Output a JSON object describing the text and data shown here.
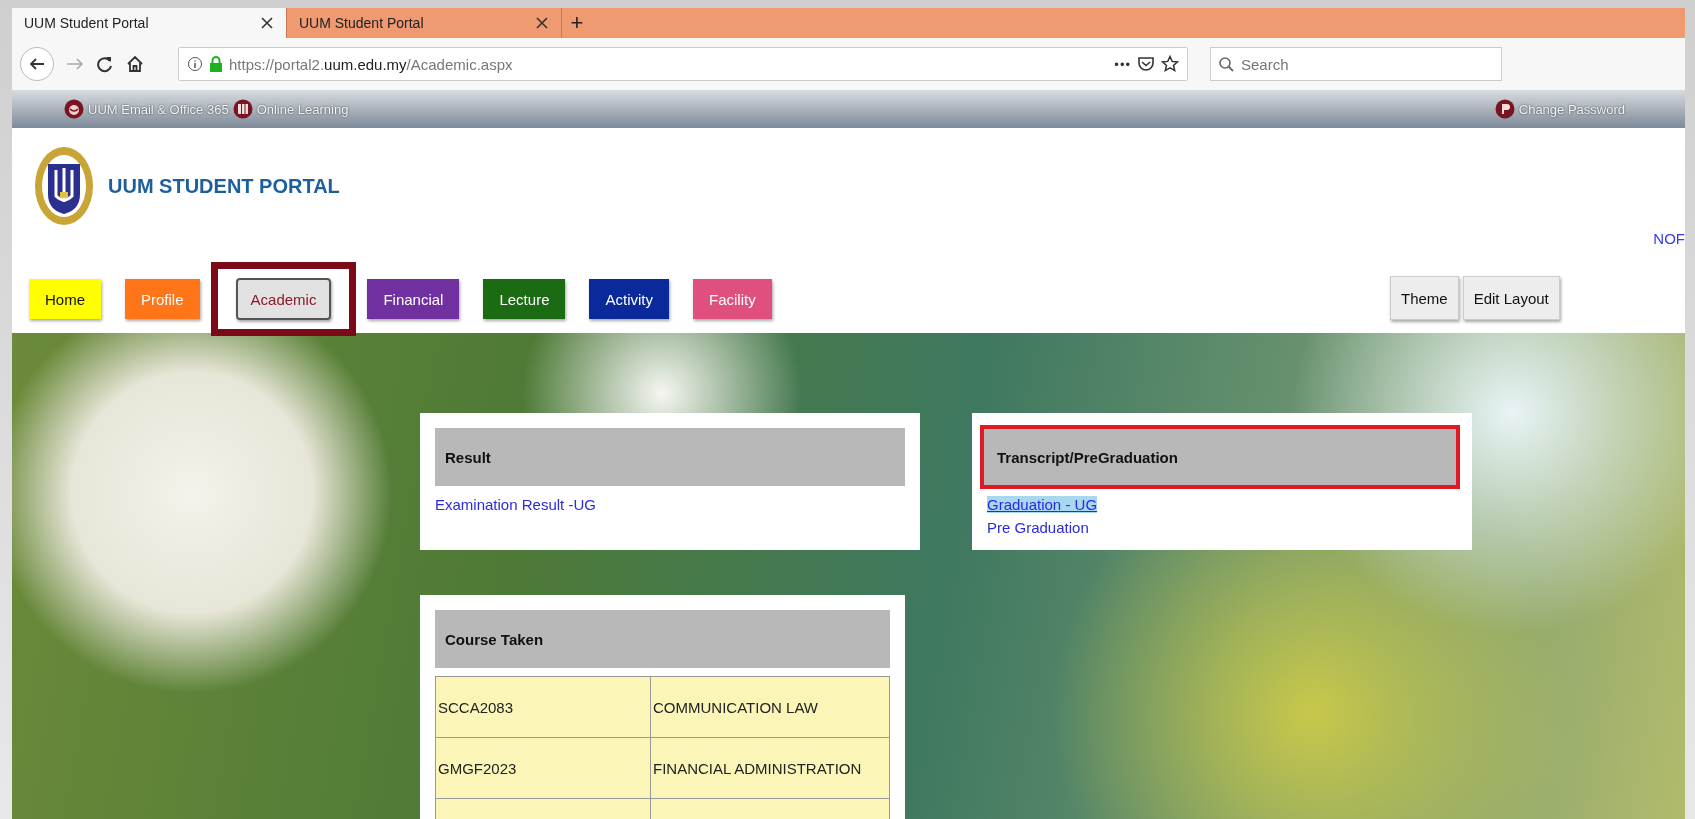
{
  "browser": {
    "tabs": [
      {
        "title": "UUM Student Portal",
        "selected": true
      },
      {
        "title": "UUM Student Portal",
        "selected": false
      }
    ],
    "new_tab": "+",
    "url_prefix": "https://portal2.",
    "url_domain": "uum.edu.my",
    "url_path": "/Academic.aspx",
    "search": {
      "placeholder": "Search"
    },
    "page_actions": "•••"
  },
  "top_links": {
    "left": [
      {
        "label": "UUM Email & Office 365"
      },
      {
        "label": "Online Learning"
      }
    ],
    "right": [
      {
        "label": "Change Password"
      }
    ]
  },
  "header": {
    "title": "UUM STUDENT PORTAL",
    "user": "NOF"
  },
  "nav": [
    {
      "label": "Home",
      "color": "#ffff00",
      "selected": false,
      "highlighted": false
    },
    {
      "label": "Profile",
      "color": "#ff7518",
      "selected": false,
      "highlighted": false
    },
    {
      "label": "Academic",
      "color": "#8b1a2a",
      "selected": true,
      "highlighted": true
    },
    {
      "label": "Financial",
      "color": "#7030a0",
      "selected": false,
      "highlighted": false
    },
    {
      "label": "Lecture",
      "color": "#1a6b12",
      "selected": false,
      "highlighted": false
    },
    {
      "label": "Activity",
      "color": "#0a2a9c",
      "selected": false,
      "highlighted": false
    },
    {
      "label": "Facility",
      "color": "#e0507e",
      "selected": false,
      "highlighted": false
    }
  ],
  "tools": [
    "Theme",
    "Edit Layout"
  ],
  "panels": {
    "result": {
      "title": "Result",
      "highlighted": false,
      "links": [
        {
          "label": "Examination Result -UG",
          "selected": false
        }
      ]
    },
    "course_taken": {
      "title": "Course Taken",
      "rows": [
        {
          "code": "SCCA2083",
          "name": "COMMUNICATION LAW"
        },
        {
          "code": "GMGF2023",
          "name": "FINANCIAL ADMINISTRATION"
        }
      ]
    },
    "transcript": {
      "title": "Transcript/PreGraduation",
      "highlighted": true,
      "links": [
        {
          "label": "Graduation - UG",
          "selected": true
        },
        {
          "label": "Pre Graduation",
          "selected": false
        }
      ]
    }
  }
}
